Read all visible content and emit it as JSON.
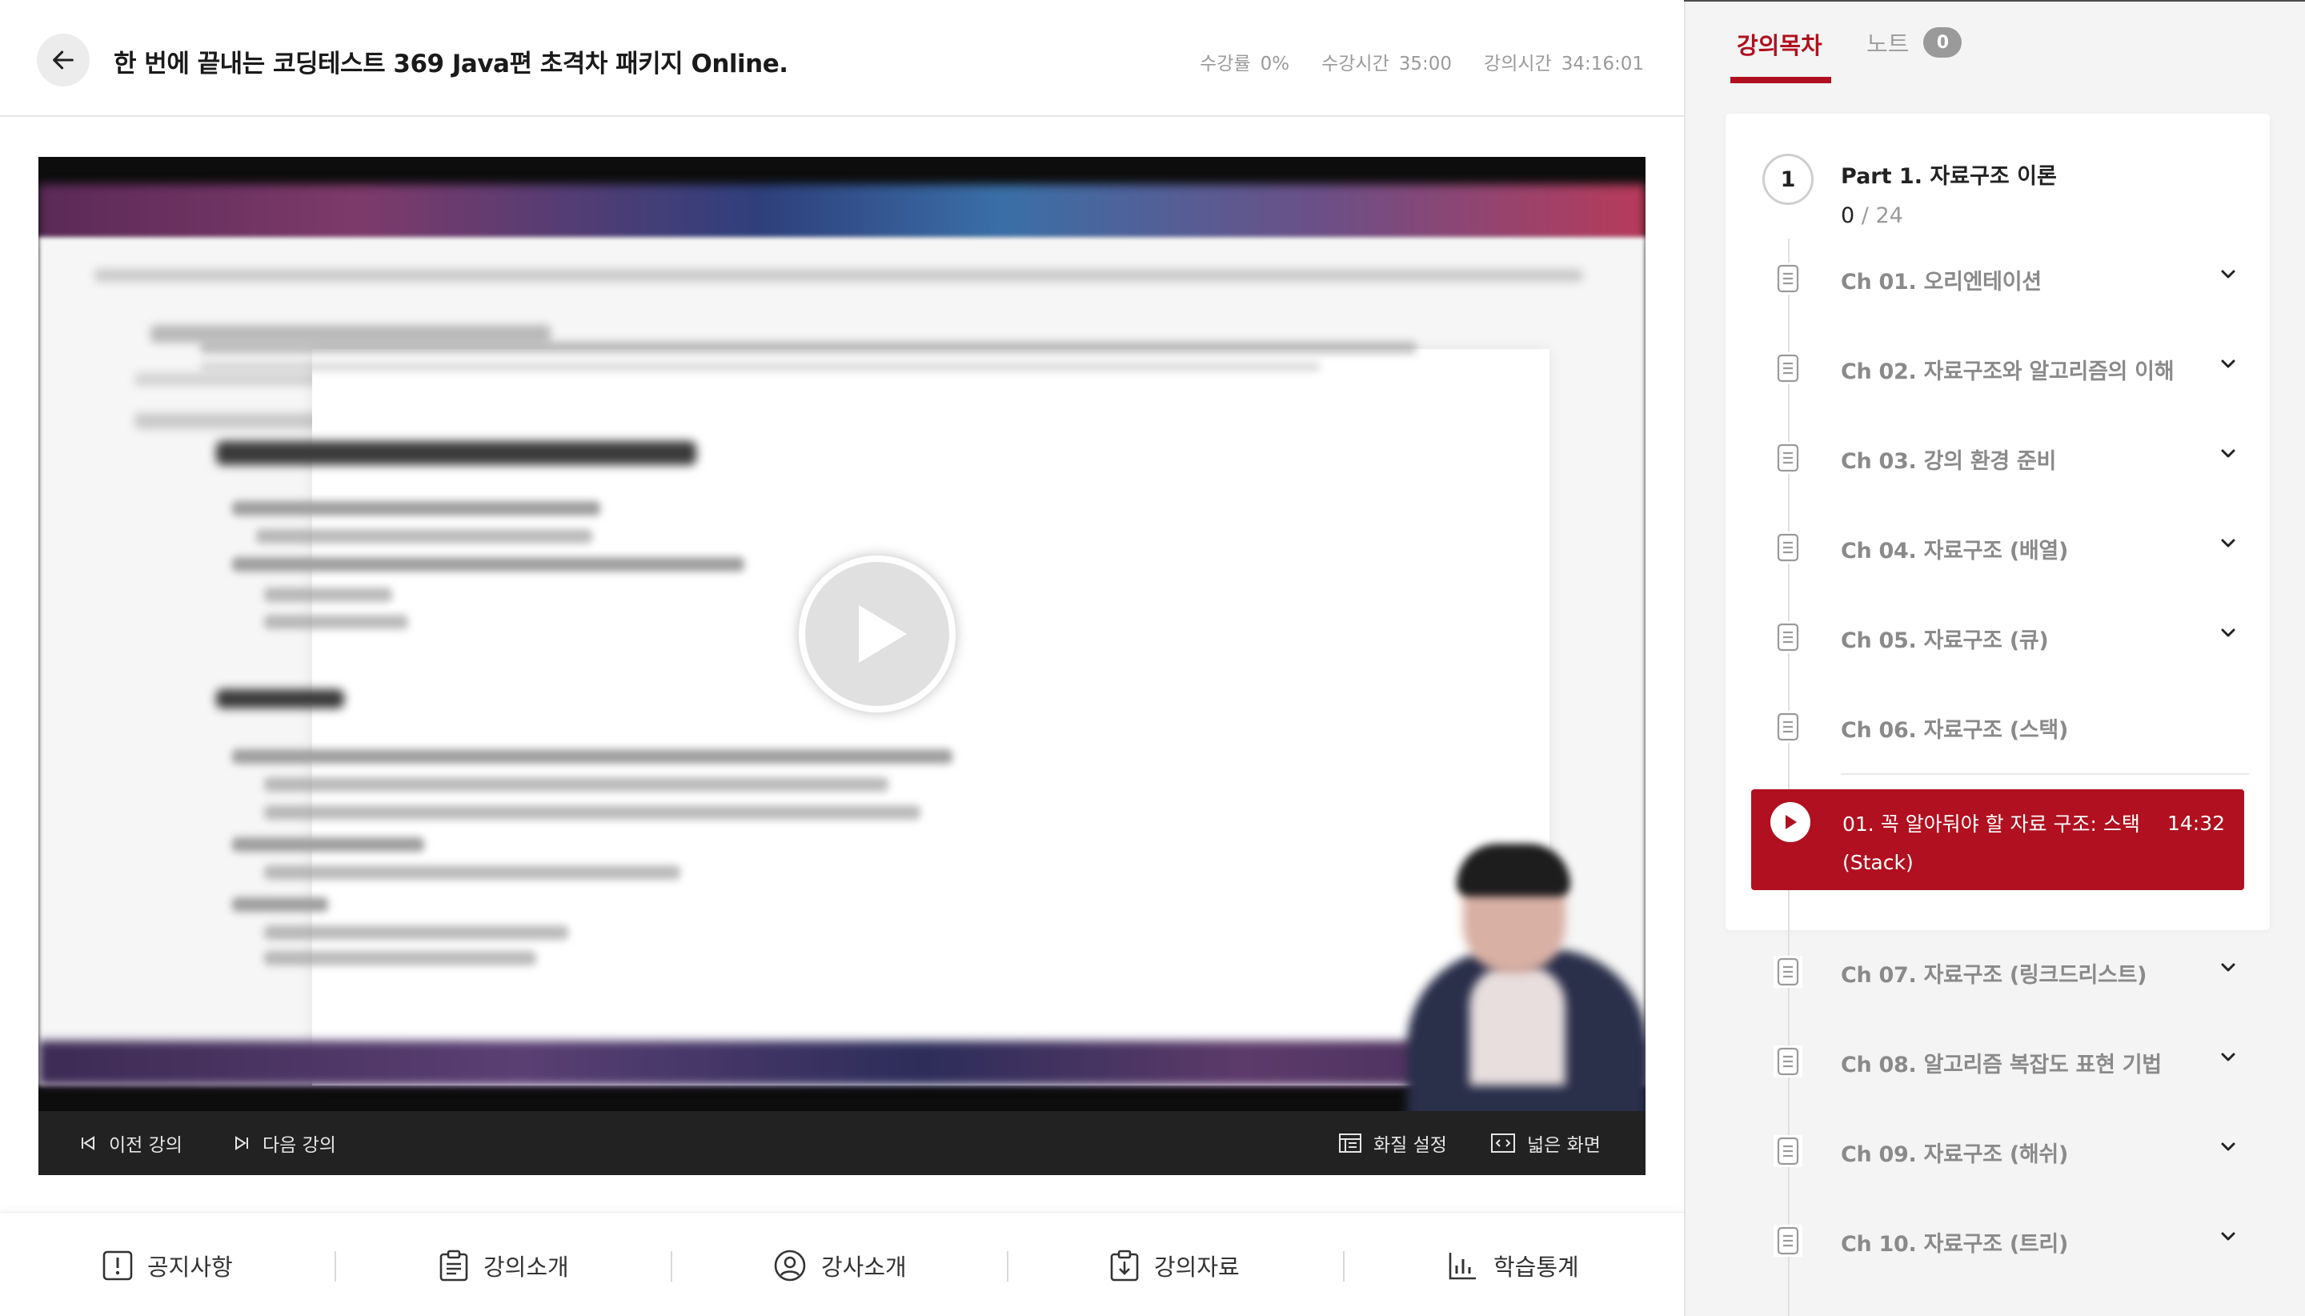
{
  "header": {
    "title": "한 번에 끝내는 코딩테스트 369 Java편 초격차 패키지 Online.",
    "stats": [
      {
        "label": "수강률",
        "value": "0%"
      },
      {
        "label": "수강시간",
        "value": "35:00"
      },
      {
        "label": "강의시간",
        "value": "34:16:01"
      }
    ]
  },
  "player": {
    "prev_label": "이전 강의",
    "next_label": "다음 강의",
    "quality_label": "화질 설정",
    "wide_label": "넓은 화면"
  },
  "bottom_tabs": [
    "공지사항",
    "강의소개",
    "강사소개",
    "강의자료",
    "학습통계"
  ],
  "sidebar": {
    "tabs": {
      "toc": "강의목차",
      "notes": "노트",
      "notes_count": "0"
    },
    "part": {
      "number": "1",
      "title": "Part 1. 자료구조 이론",
      "done": "0",
      "separator": "/",
      "total": "24"
    },
    "chapters": [
      "Ch 01. 오리엔테이션",
      "Ch 02. 자료구조와 알고리즘의 이해",
      "Ch 03. 강의 환경 준비",
      "Ch 04. 자료구조 (배열)",
      "Ch 05. 자료구조 (큐)",
      "Ch 06. 자료구조 (스택)",
      "Ch 07. 자료구조 (링크드리스트)",
      "Ch 08. 알고리즘 복잡도 표현 기법",
      "Ch 09. 자료구조 (해쉬)",
      "Ch 10. 자료구조 (트리)"
    ],
    "current_lecture": {
      "title": "01. 꼭 알아둬야 할 자료 구조: 스택 (Stack)",
      "duration": "14:32"
    }
  },
  "colors": {
    "accent": "#b0101f",
    "control_bar": "#222222",
    "muted_text": "#8a8a8a"
  }
}
